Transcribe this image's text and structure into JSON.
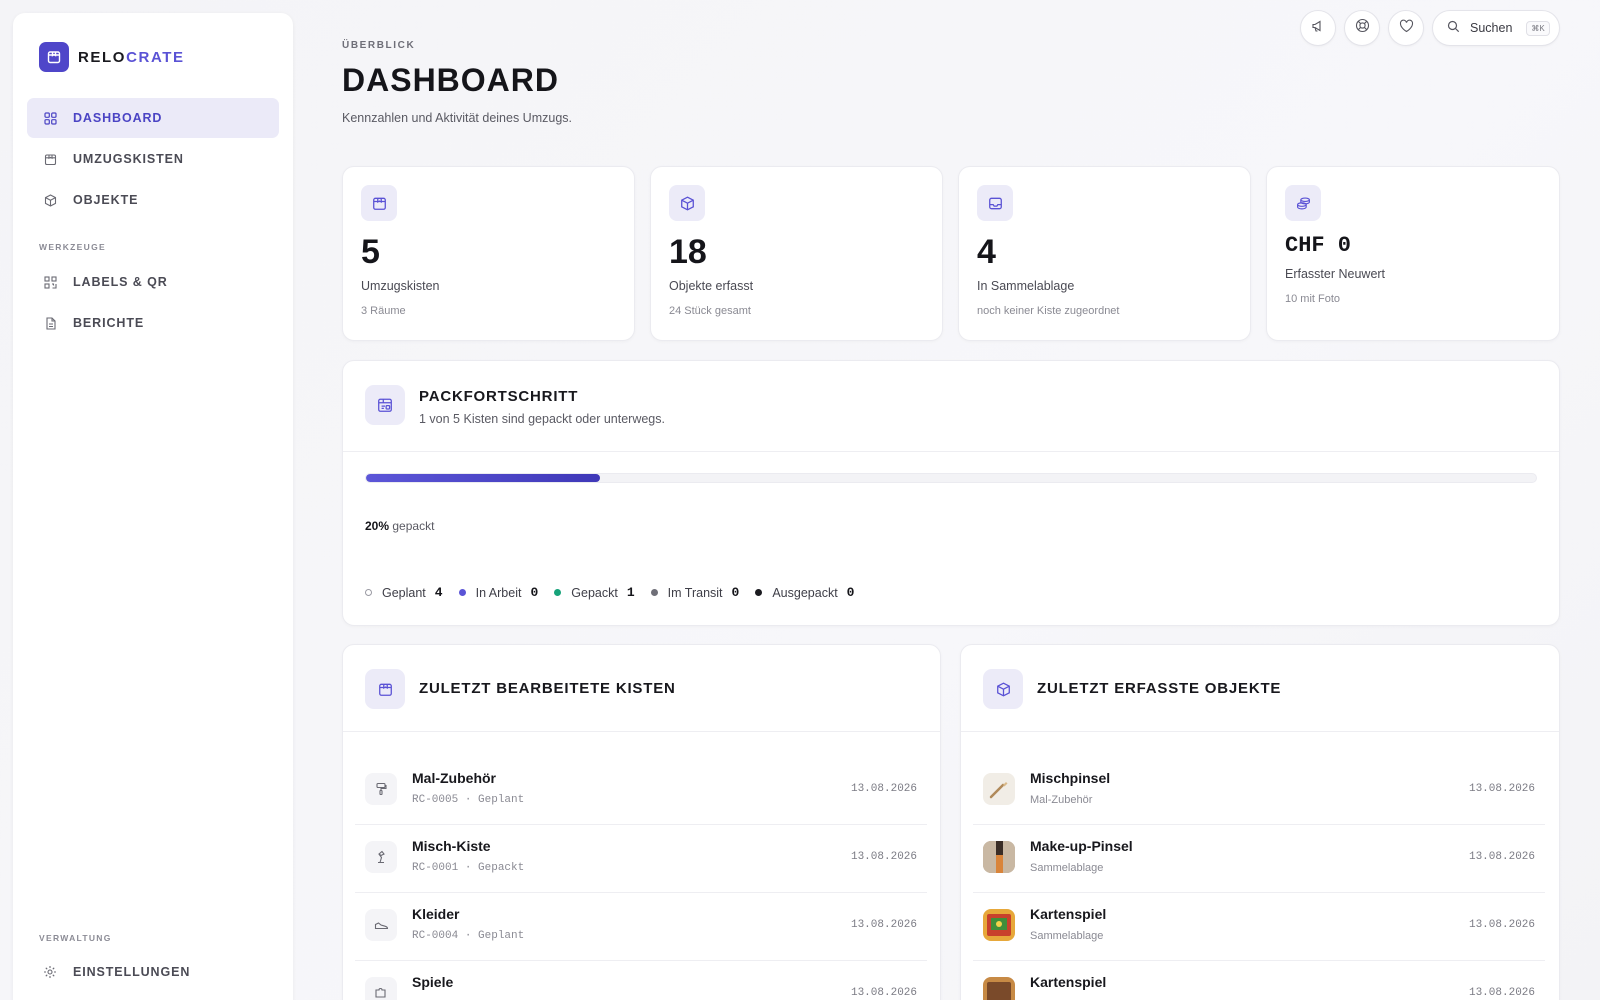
{
  "brand": {
    "part1": "RELO",
    "part2": "CRATE"
  },
  "sidebar": {
    "items": [
      {
        "label": "DASHBOARD",
        "icon": "grid-icon",
        "active": true
      },
      {
        "label": "UMZUGSKISTEN",
        "icon": "box-icon"
      },
      {
        "label": "OBJEKTE",
        "icon": "cube-icon"
      }
    ],
    "section_tools": "WERKZEUGE",
    "tools": [
      {
        "label": "LABELS & QR",
        "icon": "qr-icon"
      },
      {
        "label": "BERICHTE",
        "icon": "document-icon"
      }
    ],
    "section_admin": "VERWALTUNG",
    "admin": [
      {
        "label": "EINSTELLUNGEN",
        "icon": "gear-icon"
      }
    ]
  },
  "toolbar": {
    "search_label": "Suchen",
    "search_shortcut": "⌘K",
    "buttons": [
      "megaphone-icon",
      "lifebuoy-icon",
      "heart-icon"
    ]
  },
  "header": {
    "eyebrow": "ÜBERBLICK",
    "title": "DASHBOARD",
    "subtitle": "Kennzahlen und Aktivität deines Umzugs."
  },
  "stats": [
    {
      "value": "5",
      "label": "Umzugskisten",
      "note": "3 Räume",
      "icon": "box-icon"
    },
    {
      "value": "18",
      "label": "Objekte erfasst",
      "note": "24 Stück gesamt",
      "icon": "cube-icon"
    },
    {
      "value": "4",
      "label": "In Sammelablage",
      "note": "noch keiner Kiste zugeordnet",
      "icon": "inbox-icon"
    },
    {
      "value": "CHF 0",
      "label": "Erfasster Neuwert",
      "note": "10 mit Foto",
      "icon": "coins-icon"
    }
  ],
  "progress": {
    "title": "PACKFORTSCHRITT",
    "subtitle": "1 von 5 Kisten sind gepackt oder unterwegs.",
    "fraction": 0.2,
    "percent_label": "20%",
    "percent_suffix": "gepackt",
    "colors": {
      "fill": "#4f48c9"
    },
    "legend": [
      {
        "label": "Geplant",
        "count": "4",
        "color": "#ffffff"
      },
      {
        "label": "In Arbeit",
        "count": "0",
        "color": "#5a54d6"
      },
      {
        "label": "Gepackt",
        "count": "1",
        "color": "#17a37a"
      },
      {
        "label": "Im Transit",
        "count": "0",
        "color": "#6f6f78"
      },
      {
        "label": "Ausgepackt",
        "count": "0",
        "color": "#1b1b20"
      }
    ]
  },
  "recent_boxes": {
    "title": "ZULETZT BEARBEITETE KISTEN",
    "rows": [
      {
        "title": "Mal-Zubehör",
        "code": "RC-0005",
        "status": "Geplant",
        "date": "13.08.2026",
        "icon": "paint-roller-icon"
      },
      {
        "title": "Misch-Kiste",
        "code": "RC-0001",
        "status": "Gepackt",
        "date": "13.08.2026",
        "icon": "lamp-icon"
      },
      {
        "title": "Kleider",
        "code": "RC-0004",
        "status": "Geplant",
        "date": "13.08.2026",
        "icon": "shoe-icon"
      },
      {
        "title": "Spiele",
        "code": "",
        "status": "",
        "date": "13.08.2026",
        "icon": "puzzle-icon"
      }
    ]
  },
  "recent_objects": {
    "title": "ZULETZT ERFASSTE OBJEKTE",
    "rows": [
      {
        "title": "Mischpinsel",
        "location": "Mal-Zubehör",
        "date": "13.08.2026",
        "thumb": "brush-thumb"
      },
      {
        "title": "Make-up-Pinsel",
        "location": "Sammelablage",
        "date": "13.08.2026",
        "thumb": "makeup-brush-thumb"
      },
      {
        "title": "Kartenspiel",
        "location": "Sammelablage",
        "date": "13.08.2026",
        "thumb": "card-game-thumb"
      },
      {
        "title": "Kartenspiel",
        "location": "",
        "date": "13.08.2026",
        "thumb": "card-game-thumb"
      }
    ]
  }
}
